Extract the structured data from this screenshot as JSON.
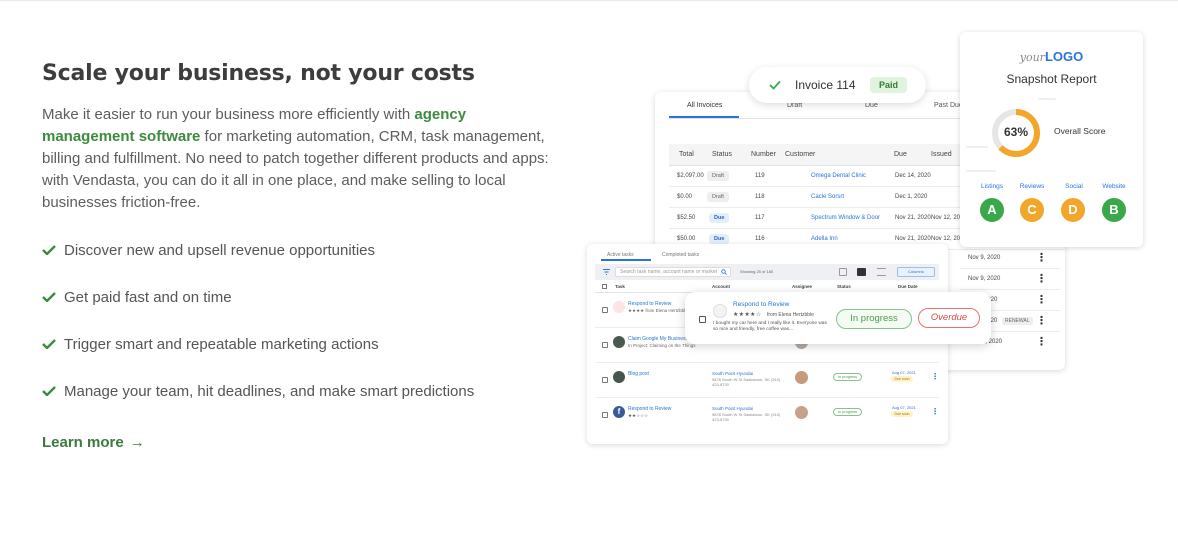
{
  "hero": {
    "title": "Scale your business, not your costs",
    "lead_before": "Make it easier to run your business more efficiently with ",
    "lead_link": "agency management software",
    "lead_after": " for marketing automation, CRM, task management, billing and fulfillment. No need to patch together different products and apps: with Vendasta, you can do it all in one place, and make selling to local businesses friction-free.",
    "benefits": [
      "Discover new and upsell revenue opportunities",
      "Get paid fast and on time",
      "Trigger smart and repeatable marketing actions",
      "Manage your team, hit deadlines, and make smart predictions"
    ],
    "learn_more": "Learn more",
    "learn_more_arrow": "→",
    "accent": "#3c8b3e"
  },
  "invoice_badge": {
    "label": "Invoice 114",
    "status": "Paid"
  },
  "invoices": {
    "tabs": [
      "All Invoices",
      "Draft",
      "Due",
      "Past Due"
    ],
    "headers": [
      "Total",
      "Status",
      "Number",
      "Customer",
      "Due",
      "Issued"
    ],
    "rows": [
      {
        "total": "$2,097.00",
        "status": "Draft",
        "number": "119",
        "customer": "Omega Dental Clinic",
        "due": "Dec 14, 2020",
        "issued": ""
      },
      {
        "total": "$0.00",
        "status": "Draft",
        "number": "118",
        "customer": "Cacle Sorsrt",
        "due": "Dec 1, 2020",
        "issued": ""
      },
      {
        "total": "$52.50",
        "status": "Due",
        "number": "117",
        "customer": "Spectrum Window & Door",
        "due": "Nov 21, 2020",
        "issued": "Nov 12, 2020"
      },
      {
        "total": "$50.00",
        "status": "Due",
        "number": "116",
        "customer": "Adella Inn",
        "due": "Nov 21, 2020",
        "issued": "Nov 12, 2020"
      }
    ],
    "extra_rows": [
      {
        "date": "Nov 9, 2020",
        "tag": ""
      },
      {
        "date": "Nov 9, 2020",
        "tag": ""
      },
      {
        "date": "2020",
        "tag": ""
      },
      {
        "date": "2020",
        "tag": "RENEWAL"
      },
      {
        "date": "4, 2020",
        "tag": ""
      }
    ]
  },
  "snapshot": {
    "logo_prefix": "your",
    "logo_main": "LOGO",
    "title": "Snapshot Report",
    "score": "63%",
    "score_value": 0.63,
    "score_label": "Overall Score",
    "grades": [
      {
        "label": "Listings",
        "grade": "A",
        "color": "#3aa84a"
      },
      {
        "label": "Reviews",
        "grade": "C",
        "color": "#f2a62a"
      },
      {
        "label": "Social",
        "grade": "D",
        "color": "#f2a62a"
      },
      {
        "label": "Website",
        "grade": "B",
        "color": "#3aa84a"
      }
    ]
  },
  "tasks": {
    "tabs": [
      "Active tasks",
      "Completed tasks"
    ],
    "search_placeholder": "Search task name, account name or market",
    "showing": "Showing 25 of 180",
    "columns_btn": "Columns",
    "headers": [
      "Task",
      "Account",
      "Assignee",
      "Status",
      "Due Date"
    ],
    "rows": [
      {
        "title": "Respond to Review",
        "sub": "★★★★  from Elena Hertzbble",
        "account": "",
        "address": "",
        "status": "",
        "date": "",
        "due": ""
      },
      {
        "title": "Claim Google My Business",
        "sub": "In Project: Claiming on the Things",
        "account": "",
        "address": "",
        "status": "",
        "date": "",
        "due": ""
      },
      {
        "title": "Blog post",
        "sub": "",
        "account": "South Point Hyundai",
        "address": "9878 South W St Saskatoon, SK (310) 423-8730",
        "status": "In progress",
        "date": "Aug 07, 2021",
        "due": "Due soon"
      },
      {
        "title": "Respond to Review",
        "sub": "★★☆☆☆",
        "account": "South Point Hyundai",
        "address": "9878 South W St Saskatoon, SK (310) 423-8730",
        "status": "In progress",
        "date": "Aug 07, 2021",
        "due": "Due soon"
      }
    ]
  },
  "review_popup": {
    "title": "Respond to Review",
    "stars": "★★★★☆",
    "from": "from Elena Hertzbble",
    "body": "I bought my car here and I really like it. Everyone was so nice and friendly, free coffee was...",
    "status_progress": "In progress",
    "status_overdue": "Overdue"
  }
}
